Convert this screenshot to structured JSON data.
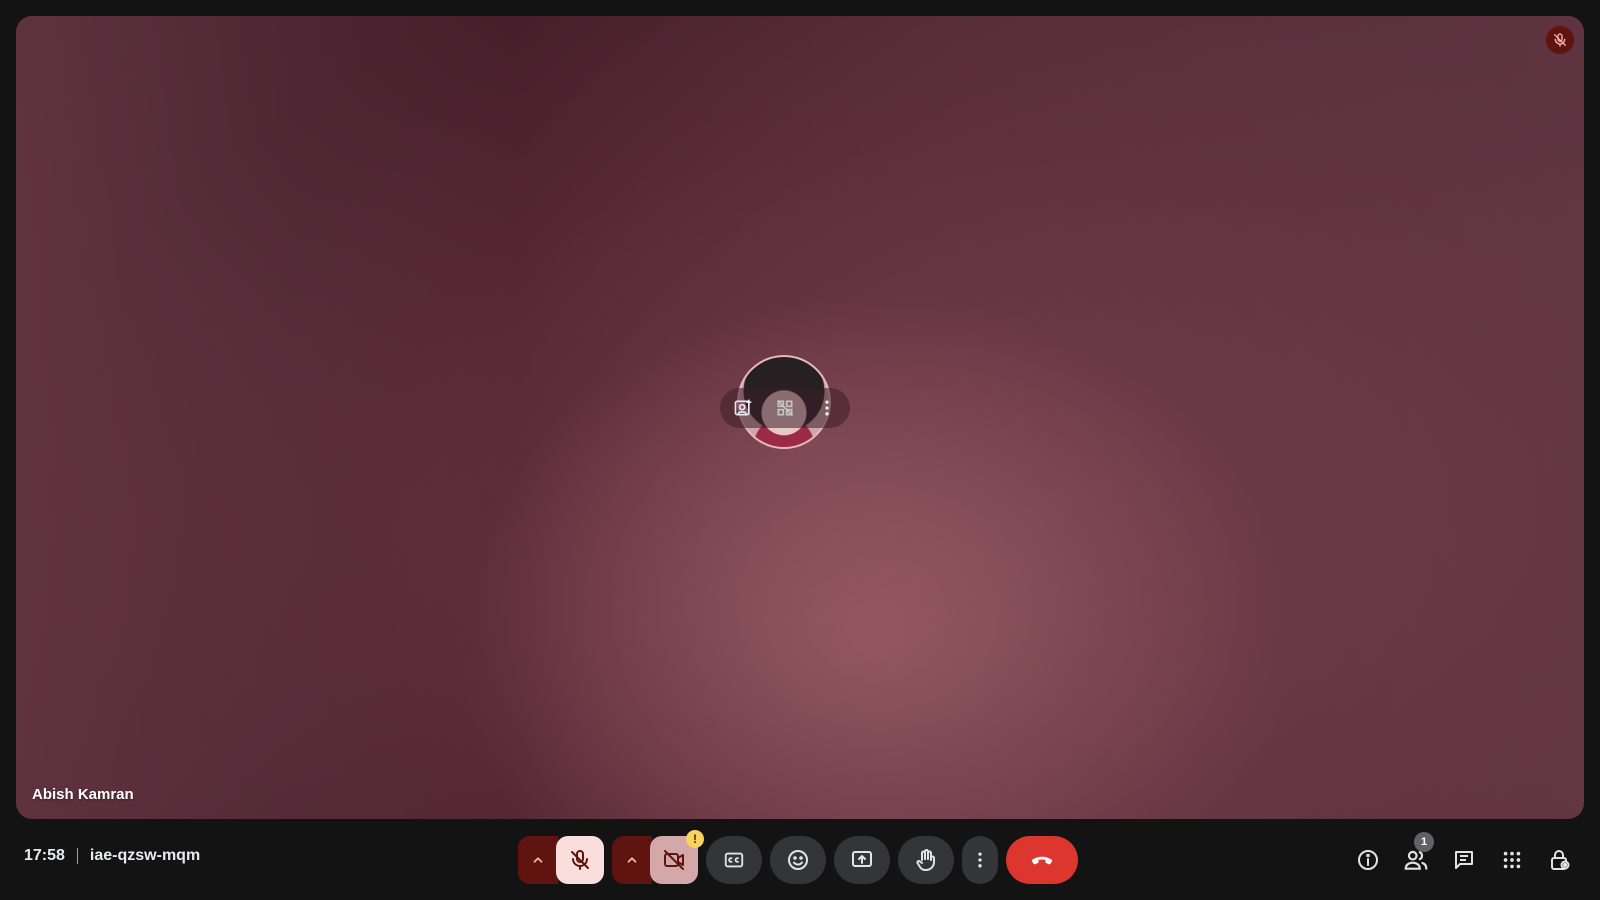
{
  "stage": {
    "participant_name": "Abish Kamran"
  },
  "meeting": {
    "time": "17:58",
    "code": "iae-qzsw-mqm"
  },
  "controls": {
    "camera_warning": "!",
    "people_count": "1"
  },
  "icons": {
    "tile_muted": "mic-off-icon",
    "avatar_actions": [
      "add-portrait-icon",
      "grid-off-icon",
      "more-vert-icon"
    ],
    "toolbar": [
      "chevron-up-icon",
      "mic-off-icon",
      "chevron-up-icon",
      "videocam-off-icon",
      "captions-icon",
      "emoji-icon",
      "present-screen-icon",
      "raise-hand-icon",
      "more-vert-icon",
      "call-end-icon"
    ],
    "right_toolbar": [
      "info-icon",
      "people-icon",
      "chat-icon",
      "apps-icon",
      "host-controls-icon"
    ]
  },
  "colors": {
    "end_call": "#dc362e",
    "mic_off_bg": "#f9dedc",
    "split_arrow_bg": "#601410",
    "warning": "#f9d35b"
  }
}
